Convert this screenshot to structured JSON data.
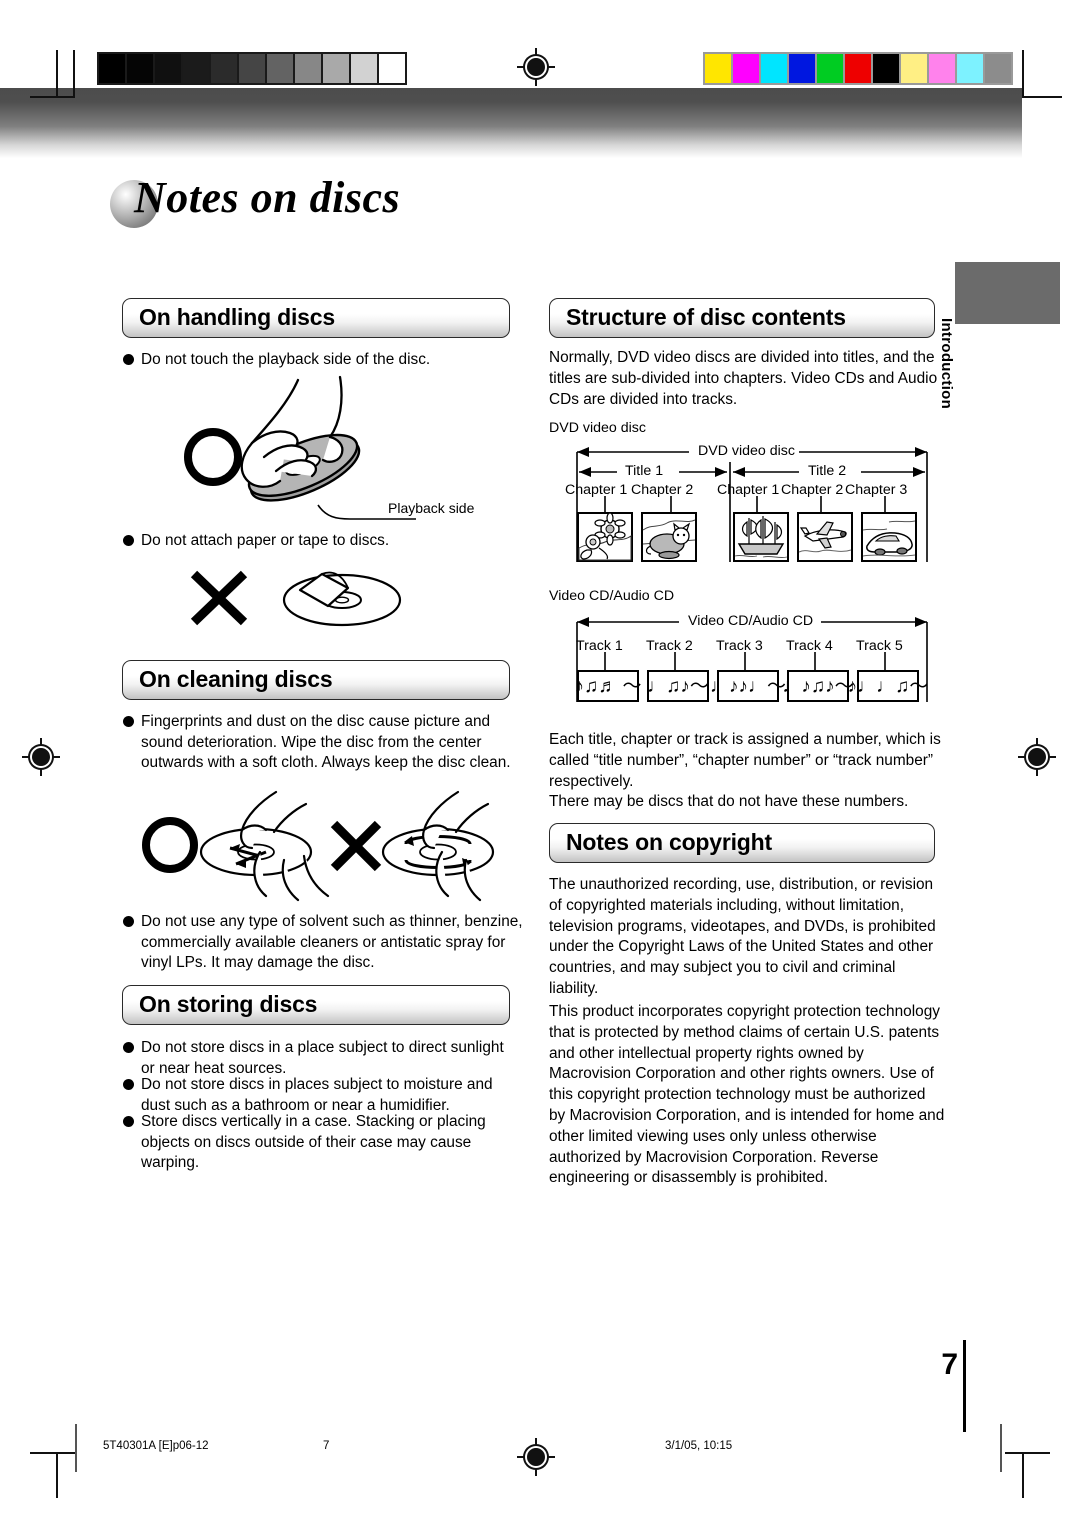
{
  "page": {
    "title": "Notes on discs",
    "number": "7",
    "side_tab": "Introduction"
  },
  "print_marks": {
    "grayscale_patches": [
      "#000000",
      "#050505",
      "#101010",
      "#1b1b1b",
      "#2b2b2b",
      "#454545",
      "#636363",
      "#878787",
      "#a9a9a9",
      "#d2d2d2",
      "#ffffff"
    ],
    "color_patches": [
      "#ffe600",
      "#ff00ff",
      "#00e5ff",
      "#0017e0",
      "#00cc22",
      "#ee0000",
      "#000000",
      "#ffef84",
      "#ff82ec",
      "#7df2ff",
      "#8c8c8c"
    ]
  },
  "left_column": {
    "handling": {
      "heading": "On handling discs",
      "bullets": [
        "Do not touch the playback side of the disc.",
        "Do not attach paper or tape to discs."
      ],
      "caption_playback_side": "Playback side"
    },
    "cleaning": {
      "heading": "On cleaning discs",
      "bullets": [
        "Fingerprints and dust on the disc cause picture and sound deterioration. Wipe the disc from the center outwards with a soft cloth. Always keep the disc clean.",
        "Do not use any type of solvent such as thinner, benzine, commercially available cleaners or antistatic spray for vinyl LPs. It may damage the disc."
      ]
    },
    "storing": {
      "heading": "On storing discs",
      "bullets": [
        "Do not store discs in a place subject to direct sunlight or near heat sources.",
        "Do not store discs in places subject to moisture and dust such as a bathroom or near a humidifier.",
        "Store discs vertically in a case. Stacking or placing objects on discs outside of their case may cause warping."
      ]
    }
  },
  "right_column": {
    "structure": {
      "heading": "Structure of disc contents",
      "intro": "Normally, DVD video discs are divided into titles, and the titles are sub-divided into chapters. Video CDs and Audio CDs are divided into tracks.",
      "dvd_caption": "DVD video disc",
      "dvd_diagram": {
        "span_label": "DVD video disc",
        "titles": [
          {
            "label": "Title 1",
            "chapters": [
              "Chapter 1",
              "Chapter 2"
            ]
          },
          {
            "label": "Title 2",
            "chapters": [
              "Chapter 1",
              "Chapter 2",
              "Chapter 3"
            ]
          }
        ],
        "thumbnails": [
          "sunflower",
          "cat",
          "sailing-ship",
          "airplane",
          "car"
        ]
      },
      "cd_caption": "Video CD/Audio CD",
      "cd_diagram": {
        "span_label": "Video CD/Audio CD",
        "tracks": [
          "Track 1",
          "Track 2",
          "Track 3",
          "Track 4",
          "Track 5"
        ],
        "track_glyphs": [
          "♪♫♬ ～",
          "♩♫♪～",
          "♩♪♪♩～",
          "♩♪♫♪～",
          "♪♩♩♫～"
        ]
      },
      "outro": "Each title, chapter or track is assigned a number, which is called “title number”, “chapter number” or “track number” respectively.\nThere may be discs that do not have these numbers."
    },
    "copyright": {
      "heading": "Notes on copyright",
      "paragraphs": [
        "The unauthorized recording, use, distribution, or revision of copyrighted materials including, without limitation, television programs, videotapes, and DVDs, is prohibited under the Copyright Laws of the United States and other countries, and may subject you to civil and criminal liability.",
        "This product incorporates copyright protection technology that is protected by method claims of certain U.S. patents and other intellectual property rights owned by Macrovision Corporation and other rights owners. Use of this copyright protection technology must be authorized by Macrovision Corporation, and is intended for home and other limited viewing uses only unless otherwise authorized by Macrovision Corporation. Reverse engineering or disassembly is prohibited."
      ]
    }
  },
  "footer": {
    "document_code": "5T40301A [E]p06-12",
    "page_number": "7",
    "timestamp": "3/1/05, 10:15"
  }
}
